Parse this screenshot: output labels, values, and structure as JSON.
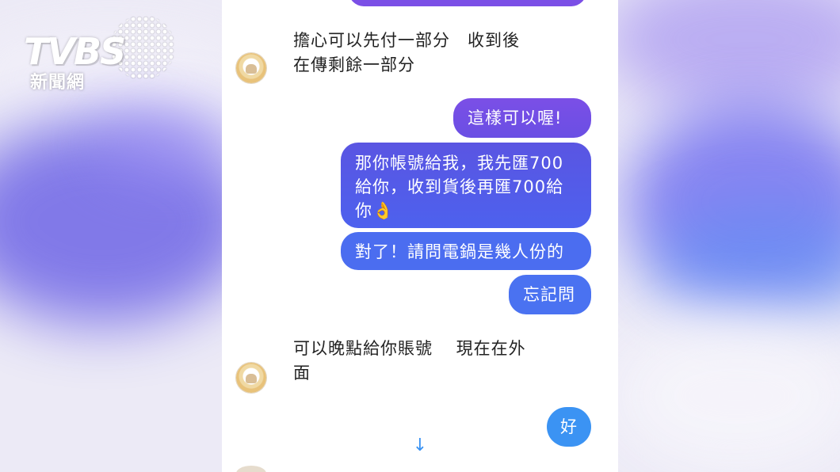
{
  "logo": {
    "wordmark": "TVBS",
    "subtitle": "新聞網"
  },
  "chat": {
    "messages": [
      {
        "side": "received",
        "lines": [
          "擔心可以先付一部分　收到後",
          "在傳剩餘一部分"
        ]
      },
      {
        "side": "sent",
        "text": "這樣可以喔!"
      },
      {
        "side": "sent",
        "lines": [
          "那你帳號給我，我先匯700",
          "給你，收到貨後再匯700給",
          "你"
        ],
        "emoji": "👌"
      },
      {
        "side": "sent",
        "text": "對了！請問電鍋是幾人份的"
      },
      {
        "side": "sent",
        "text": "忘記問"
      },
      {
        "side": "received",
        "lines": [
          "可以晚點給你賬號　 現在在外",
          "面"
        ]
      },
      {
        "side": "sent",
        "text": "好"
      }
    ]
  },
  "icons": {
    "scroll_down": "arrow-down-icon",
    "avatar": "contact-avatar"
  },
  "colors": {
    "bubble_purple": "#7b4fe6",
    "bubble_indigo": "#5a55e2",
    "bubble_blue": "#4b6df0",
    "bubble_sky": "#3b93f3"
  }
}
